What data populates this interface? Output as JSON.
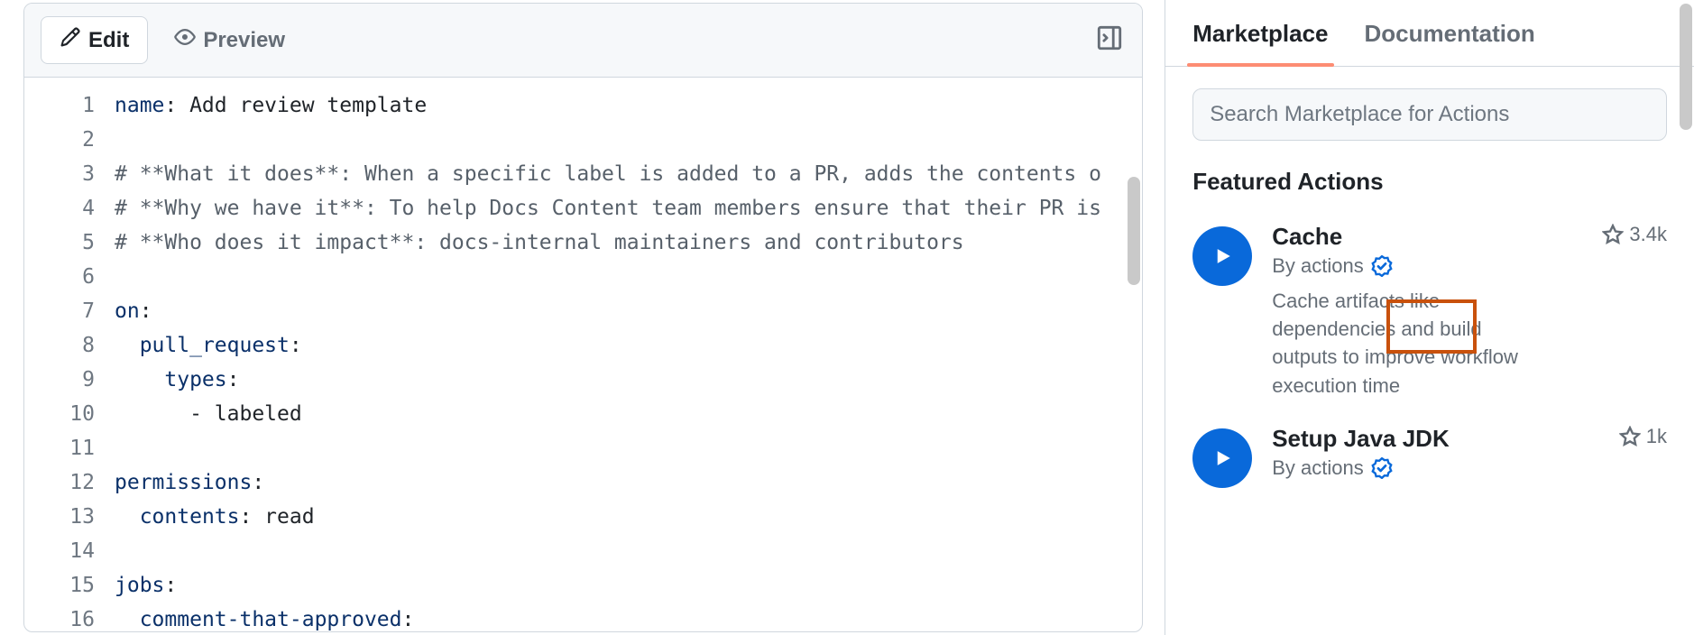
{
  "toolbar": {
    "edit_label": "Edit",
    "preview_label": "Preview"
  },
  "code": {
    "lines": [
      {
        "n": 1,
        "segments": [
          {
            "t": "name",
            "c": "tok-key"
          },
          {
            "t": ": Add review template",
            "c": "tok-plain"
          }
        ]
      },
      {
        "n": 2,
        "segments": [
          {
            "t": "",
            "c": "tok-plain"
          }
        ]
      },
      {
        "n": 3,
        "segments": [
          {
            "t": "# **What it does**: When a specific label is added to a PR, adds the contents o",
            "c": "tok-comment"
          }
        ]
      },
      {
        "n": 4,
        "segments": [
          {
            "t": "# **Why we have it**: To help Docs Content team members ensure that their PR is",
            "c": "tok-comment"
          }
        ]
      },
      {
        "n": 5,
        "segments": [
          {
            "t": "# **Who does it impact**: docs-internal maintainers and contributors",
            "c": "tok-comment"
          }
        ]
      },
      {
        "n": 6,
        "segments": [
          {
            "t": "",
            "c": "tok-plain"
          }
        ]
      },
      {
        "n": 7,
        "segments": [
          {
            "t": "on",
            "c": "tok-key"
          },
          {
            "t": ":",
            "c": "tok-plain"
          }
        ]
      },
      {
        "n": 8,
        "segments": [
          {
            "t": "  ",
            "c": "tok-plain"
          },
          {
            "t": "pull_request",
            "c": "tok-key"
          },
          {
            "t": ":",
            "c": "tok-plain"
          }
        ]
      },
      {
        "n": 9,
        "segments": [
          {
            "t": "    ",
            "c": "tok-plain"
          },
          {
            "t": "types",
            "c": "tok-key"
          },
          {
            "t": ":",
            "c": "tok-plain"
          }
        ]
      },
      {
        "n": 10,
        "segments": [
          {
            "t": "      - labeled",
            "c": "tok-plain"
          }
        ]
      },
      {
        "n": 11,
        "segments": [
          {
            "t": "",
            "c": "tok-plain"
          }
        ]
      },
      {
        "n": 12,
        "segments": [
          {
            "t": "permissions",
            "c": "tok-key"
          },
          {
            "t": ":",
            "c": "tok-plain"
          }
        ]
      },
      {
        "n": 13,
        "segments": [
          {
            "t": "  ",
            "c": "tok-plain"
          },
          {
            "t": "contents",
            "c": "tok-key"
          },
          {
            "t": ": read",
            "c": "tok-plain"
          }
        ]
      },
      {
        "n": 14,
        "segments": [
          {
            "t": "",
            "c": "tok-plain"
          }
        ]
      },
      {
        "n": 15,
        "segments": [
          {
            "t": "jobs",
            "c": "tok-key"
          },
          {
            "t": ":",
            "c": "tok-plain"
          }
        ]
      },
      {
        "n": 16,
        "segments": [
          {
            "t": "  ",
            "c": "tok-plain"
          },
          {
            "t": "comment-that-approved",
            "c": "tok-key"
          },
          {
            "t": ":",
            "c": "tok-plain"
          }
        ]
      }
    ]
  },
  "marketplace": {
    "tabs": {
      "marketplace": "Marketplace",
      "documentation": "Documentation"
    },
    "search_placeholder": "Search Marketplace for Actions",
    "featured_heading": "Featured Actions",
    "by_prefix": "By",
    "actions": [
      {
        "title": "Cache",
        "author": "actions",
        "stars": "3.4k",
        "description": "Cache artifacts like dependencies and build outputs to improve workflow execution time"
      },
      {
        "title": "Setup Java JDK",
        "author": "actions",
        "stars": "1k",
        "description": ""
      }
    ]
  },
  "colors": {
    "accent_blue": "#0969da",
    "highlight_orange": "#c9510c",
    "tab_underline": "#fd8c73"
  }
}
